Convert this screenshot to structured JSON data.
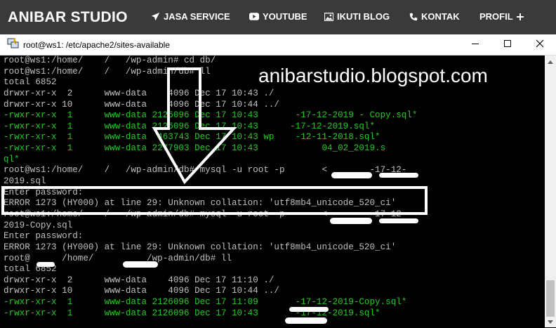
{
  "nav": {
    "brand": "ANIBAR STUDIO",
    "items": [
      {
        "label": "JASA SERVICE",
        "icon": "paper-plane-icon"
      },
      {
        "label": "YOUTUBE",
        "icon": "youtube-icon"
      },
      {
        "label": "IKUTI BLOG",
        "icon": "image-icon"
      },
      {
        "label": "KONTAK",
        "icon": "phone-icon"
      },
      {
        "label": "PROFIL",
        "icon": "plus-icon"
      }
    ]
  },
  "window": {
    "title": "root@ws1: /etc/apache2/sites-available",
    "icon": "putty-icon"
  },
  "watermark": "anibarstudio.blogspot.com",
  "terminal": {
    "lines": [
      {
        "text": "root@ws1:/home/    /   /wp-admin# cd db/",
        "color": "default"
      },
      {
        "text": "root@ws1:/home/    /   /wp-admin/db# ll",
        "color": "default"
      },
      {
        "text": "total 6852",
        "color": "default"
      },
      {
        "text": "drwxr-xr-x  2      www-data    4096 Dec 17 10:43 ./",
        "color": "default"
      },
      {
        "text": "drwxr-xr-x 10      www-data    4096 Dec 17 10:44 ../",
        "color": "default"
      },
      {
        "text": "-rwxr-xr-x  1      www-data 2126096 Dec 17 10:43       -17-12-2019 - Copy.sql*",
        "color": "green"
      },
      {
        "text": "-rwxr-xr-x  1      www-data 2126096 Dec 17 10:43      -17-12-2019.sql*",
        "color": "green"
      },
      {
        "text": "-rwxr-xr-x  1      www-data  463743 Dec 17 10:43 wp    -12-11-2018.sql*",
        "color": "green"
      },
      {
        "text": "-rwxr-xr-x  1      www-data 2277903 Dec 17 10:43            04_02_2019.s",
        "color": "green"
      },
      {
        "text": "ql*",
        "color": "green"
      },
      {
        "text": "root@ws1:/home/    /   /wp-admin/db# mysql -u root -p       <        -17-12-",
        "color": "default"
      },
      {
        "text": "2019.sql",
        "color": "default"
      },
      {
        "text": "Enter password:",
        "color": "default"
      },
      {
        "text": "ERROR 1273 (HY000) at line 29: Unknown collation: 'utf8mb4_unicode_520_ci'",
        "color": "default"
      },
      {
        "text": "root@ws1:/home/    /   /wp-admin/db# mysql -u root -p       <        -17-12-",
        "color": "default"
      },
      {
        "text": "2019-Copy.sql",
        "color": "default"
      },
      {
        "text": "Enter password:",
        "color": "default"
      },
      {
        "text": "ERROR 1273 (HY000) at line 29: Unknown collation: 'utf8mb4_unicode_520_ci'",
        "color": "default"
      },
      {
        "text": "root@      /home/          /wp-admin/db# ll",
        "color": "default"
      },
      {
        "text": "total 6852",
        "color": "default"
      },
      {
        "text": "drwxr-xr-x  2      www-data    4096 Dec 17 11:10 ./",
        "color": "default"
      },
      {
        "text": "drwxr-xr-x 10      www-data    4096 Dec 17 10:44 ../",
        "color": "default"
      },
      {
        "text": "-rwxr-xr-x  1      www-data 2126096 Dec 17 11:09       -17-12-2019-Copy.sql*",
        "color": "green"
      },
      {
        "text": "-rwxr-xr-x  1      www-data 2126096 Dec 17 10:43       -17-12-2019.sql*",
        "color": "green"
      }
    ]
  }
}
